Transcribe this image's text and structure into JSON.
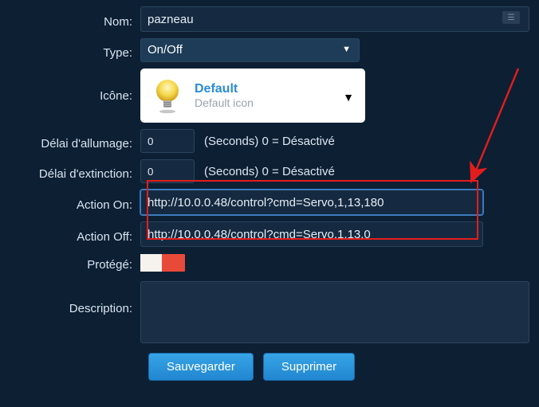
{
  "labels": {
    "nom": "Nom:",
    "type": "Type:",
    "icone": "Icône:",
    "delai_allumage": "Délai d'allumage:",
    "delai_extinction": "Délai d'extinction:",
    "action_on": "Action On:",
    "action_off": "Action Off:",
    "protege": "Protégé:",
    "description": "Description:"
  },
  "fields": {
    "nom_value": "pazneau",
    "type_value": "On/Off",
    "icon_title": "Default",
    "icon_subtitle": "Default icon",
    "delai_allumage_value": "0",
    "delai_extinction_value": "0",
    "delay_hint": "(Seconds) 0 = Désactivé",
    "action_on_value": "http://10.0.0.48/control?cmd=Servo,1,13,180",
    "action_off_value": "http://10.0.0.48/control?cmd=Servo,1,13,0",
    "description_value": ""
  },
  "buttons": {
    "save": "Sauvegarder",
    "delete": "Supprimer"
  }
}
